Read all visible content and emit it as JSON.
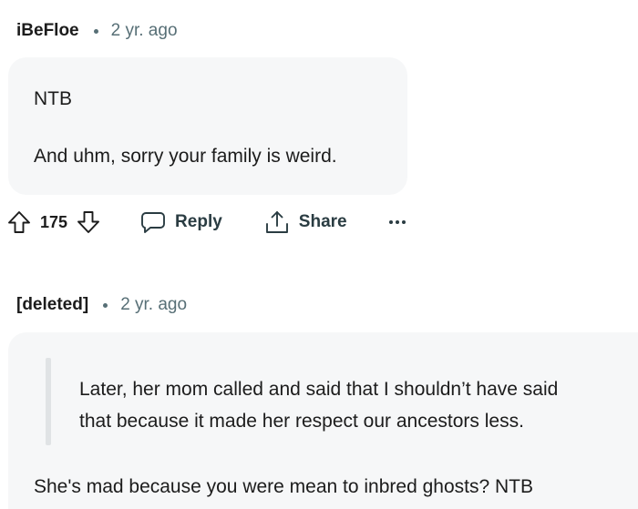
{
  "comments": [
    {
      "author": "iBeFloe",
      "time": "2 yr. ago",
      "body": [
        "NTB",
        "And uhm, sorry your family is weird."
      ],
      "votes": "175",
      "actions": {
        "reply": "Reply",
        "share": "Share"
      }
    },
    {
      "author": "[deleted]",
      "time": "2 yr. ago",
      "quote": [
        "Later, her mom called and said that I shouldn’t have said",
        "that because it made her respect our ancestors less."
      ],
      "body": [
        "She's mad because you were mean to inbred ghosts? NTB"
      ]
    }
  ],
  "icons": {
    "upvote": "arrow-up-outline-icon",
    "downvote": "arrow-down-outline-icon",
    "reply": "speech-bubble-icon",
    "share": "share-upload-icon",
    "more": "ellipsis-icon"
  },
  "colors": {
    "bubble_bg": "#f6f7f8",
    "meta_text": "#576f76",
    "quote_bar": "#e0e3e5"
  }
}
